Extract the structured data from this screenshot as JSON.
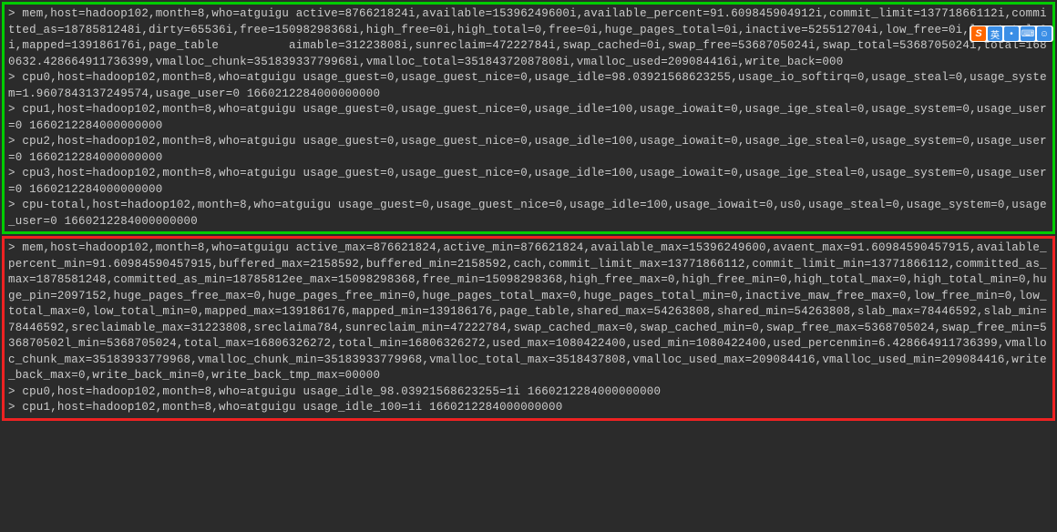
{
  "ime": {
    "logo": "S",
    "btn1": "英",
    "btn2": "•",
    "btn3": "⌨",
    "btn4": "☺"
  },
  "green": {
    "l0": "> mem,host=hadoop102,month=8,who=atguigu active=876621824i,available=15396249600i,available_percent=91.609845904912i,commit_limit=13771866112i,committed_as=1878581248i,dirty=65536i,free=15098298368i,high_free=0i,high_total=0,free=0i,huge_pages_total=0i,inactive=525512704i,low_free=0i,low_total=0i,mapped=139186176i,page_table          aimable=31223808i,sunreclaim=47222784i,swap_cached=0i,swap_free=5368705024i,swap_total=5368705024i,total=1680632.428664911736399,vmalloc_chunk=35183933779968i,vmalloc_total=35184372087808i,vmalloc_used=209084416i,write_back=000",
    "l1": "> cpu0,host=hadoop102,month=8,who=atguigu usage_guest=0,usage_guest_nice=0,usage_idle=98.03921568623255,usage_io_softirq=0,usage_steal=0,usage_system=1.9607843137249574,usage_user=0 1660212284000000000",
    "l2": "> cpu1,host=hadoop102,month=8,who=atguigu usage_guest=0,usage_guest_nice=0,usage_idle=100,usage_iowait=0,usage_ige_steal=0,usage_system=0,usage_user=0 1660212284000000000",
    "l3": "> cpu2,host=hadoop102,month=8,who=atguigu usage_guest=0,usage_guest_nice=0,usage_idle=100,usage_iowait=0,usage_ige_steal=0,usage_system=0,usage_user=0 1660212284000000000",
    "l4": "> cpu3,host=hadoop102,month=8,who=atguigu usage_guest=0,usage_guest_nice=0,usage_idle=100,usage_iowait=0,usage_ige_steal=0,usage_system=0,usage_user=0 1660212284000000000",
    "l5": "> cpu-total,host=hadoop102,month=8,who=atguigu usage_guest=0,usage_guest_nice=0,usage_idle=100,usage_iowait=0,us0,usage_steal=0,usage_system=0,usage_user=0 1660212284000000000"
  },
  "red": {
    "l0": "> mem,host=hadoop102,month=8,who=atguigu active_max=876621824,active_min=876621824,available_max=15396249600,avaent_max=91.60984590457915,available_percent_min=91.60984590457915,buffered_max=2158592,buffered_min=2158592,cach,commit_limit_max=13771866112,commit_limit_min=13771866112,committed_as_max=1878581248,committed_as_min=18785812ee_max=15098298368,free_min=15098298368,high_free_max=0,high_free_min=0,high_total_max=0,high_total_min=0,huge_pin=2097152,huge_pages_free_max=0,huge_pages_free_min=0,huge_pages_total_max=0,huge_pages_total_min=0,inactive_maw_free_max=0,low_free_min=0,low_total_max=0,low_total_min=0,mapped_max=139186176,mapped_min=139186176,page_table,shared_max=54263808,shared_min=54263808,slab_max=78446592,slab_min=78446592,sreclaimable_max=31223808,sreclaima784,sunreclaim_min=47222784,swap_cached_max=0,swap_cached_min=0,swap_free_max=5368705024,swap_free_min=536870502l_min=5368705024,total_max=16806326272,total_min=16806326272,used_max=1080422400,used_min=1080422400,used_percenmin=6.428664911736399,vmalloc_chunk_max=35183933779968,vmalloc_chunk_min=35183933779968,vmalloc_total_max=3518437808,vmalloc_used_max=209084416,vmalloc_used_min=209084416,write_back_max=0,write_back_min=0,write_back_tmp_max=00000",
    "l1": "> cpu0,host=hadoop102,month=8,who=atguigu usage_idle_98.03921568623255=1i 1660212284000000000",
    "l2": "> cpu1,host=hadoop102,month=8,who=atguigu usage_idle_100=1i 1660212284000000000"
  }
}
